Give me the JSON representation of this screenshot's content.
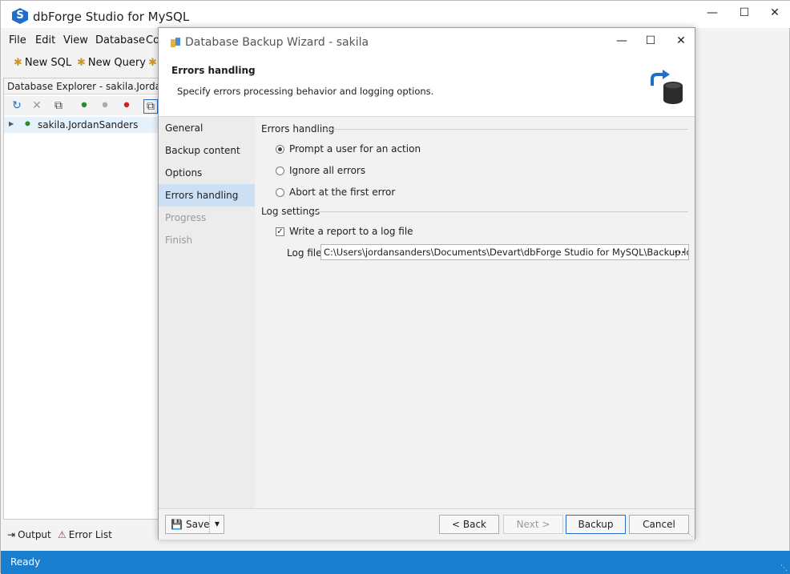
{
  "app": {
    "title": "dbForge Studio for MySQL",
    "logo_letter": "S"
  },
  "menu": [
    "File",
    "Edit",
    "View",
    "Database",
    "Co"
  ],
  "toolbar": {
    "new_sql": "New SQL",
    "new_query": "New Query"
  },
  "explorer": {
    "header": "Database Explorer - sakila.JordanSanders",
    "tree_item": "sakila.JordanSanders"
  },
  "bottom_tabs": {
    "output": "Output",
    "error_list": "Error List"
  },
  "status": {
    "text": "Ready"
  },
  "wizard": {
    "title": "Database Backup Wizard - sakila",
    "heading": "Errors handling",
    "subheading": "Specify errors processing behavior and logging options.",
    "nav": [
      {
        "label": "General",
        "state": "normal"
      },
      {
        "label": "Backup content",
        "state": "normal"
      },
      {
        "label": "Options",
        "state": "normal"
      },
      {
        "label": "Errors handling",
        "state": "active"
      },
      {
        "label": "Progress",
        "state": "disabled"
      },
      {
        "label": "Finish",
        "state": "disabled"
      }
    ],
    "errors_section": "Errors handling",
    "radios": [
      {
        "label": "Prompt a user for an action",
        "checked": true
      },
      {
        "label": "Ignore all errors",
        "checked": false
      },
      {
        "label": "Abort at the first error",
        "checked": false
      }
    ],
    "log_section": "Log settings",
    "write_report_label": "Write a report to a log file",
    "write_report_checked": true,
    "log_file_label": "Log file:",
    "log_file_value": "C:\\Users\\jordansanders\\Documents\\Devart\\dbForge Studio for MySQL\\Backup.log",
    "browse_label": "···",
    "buttons": {
      "save": "Save",
      "back": "< Back",
      "next": "Next >",
      "backup": "Backup",
      "cancel": "Cancel"
    }
  },
  "colors": {
    "accent": "#1a7ecf",
    "nav_active": "#cce0f5"
  }
}
